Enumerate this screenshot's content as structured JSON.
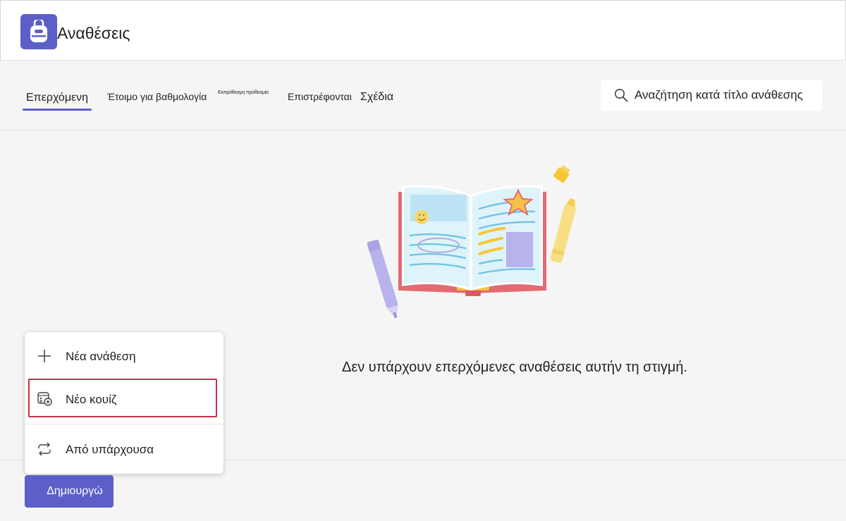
{
  "app": {
    "title": "Αναθέσεις",
    "icon": "backpack-icon",
    "accent_color": "#5b5fc7"
  },
  "tabs": [
    {
      "label": "Επερχόμενη",
      "active": true
    },
    {
      "label": "Έτοιμο για βαθμολογία",
      "active": false
    },
    {
      "label": "Εκπρόθεσμη προθεσμία",
      "active": false
    },
    {
      "label": "Επιστρέφονται",
      "active": false
    },
    {
      "label": "Σχέδια",
      "active": false
    }
  ],
  "search": {
    "placeholder": "Αναζήτηση κατά τίτλο ανάθεσης",
    "icon": "search-icon"
  },
  "empty_state": {
    "message": "Δεν υπάρχουν επερχόμενες αναθέσεις αυτήν τη στιγμή.",
    "illustration": "open-book-illustration"
  },
  "create_menu": {
    "items": [
      {
        "label": "Νέα ανάθεση",
        "icon": "plus-icon"
      },
      {
        "label": "Νέο κουίζ",
        "icon": "quiz-add-icon",
        "highlighted": true
      },
      {
        "label": "Από υπάρχουσα",
        "icon": "reuse-arrows-icon"
      }
    ],
    "highlight_color": "#c4314b"
  },
  "create_button": {
    "label": "Δημιουργώ"
  }
}
